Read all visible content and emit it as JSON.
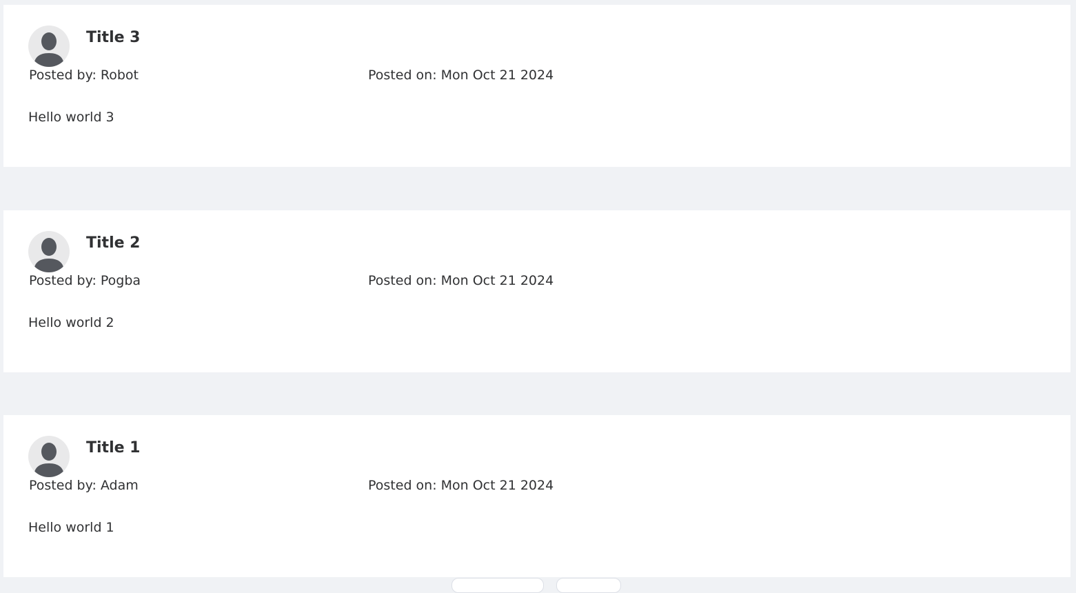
{
  "posts": [
    {
      "title": "Title 3",
      "author_label": "Posted by",
      "author_sep": ":",
      "author": "Robot",
      "date_label": "Posted on",
      "date_sep": ":",
      "date": "Mon Oct 21 2024",
      "content": "Hello world 3",
      "avatar_icon": "user-silhouette-icon"
    },
    {
      "title": "Title 2",
      "author_label": "Posted by",
      "author_sep": ":",
      "author": "Pogba",
      "date_label": "Posted on",
      "date_sep": ":",
      "date": "Mon Oct 21 2024",
      "content": "Hello world 2",
      "avatar_icon": "user-silhouette-icon"
    },
    {
      "title": "Title 1",
      "author_label": "Posted by",
      "author_sep": ":",
      "author": "Adam",
      "date_label": "Posted on",
      "date_sep": ":",
      "date": "Mon Oct 21 2024",
      "content": "Hello world 1",
      "avatar_icon": "user-silhouette-icon"
    }
  ],
  "colors": {
    "page_background": "#f0f2f5",
    "card_background": "#ffffff",
    "text": "#303133",
    "avatar_background": "#e9e9ea",
    "avatar_figure": "#55585e"
  }
}
